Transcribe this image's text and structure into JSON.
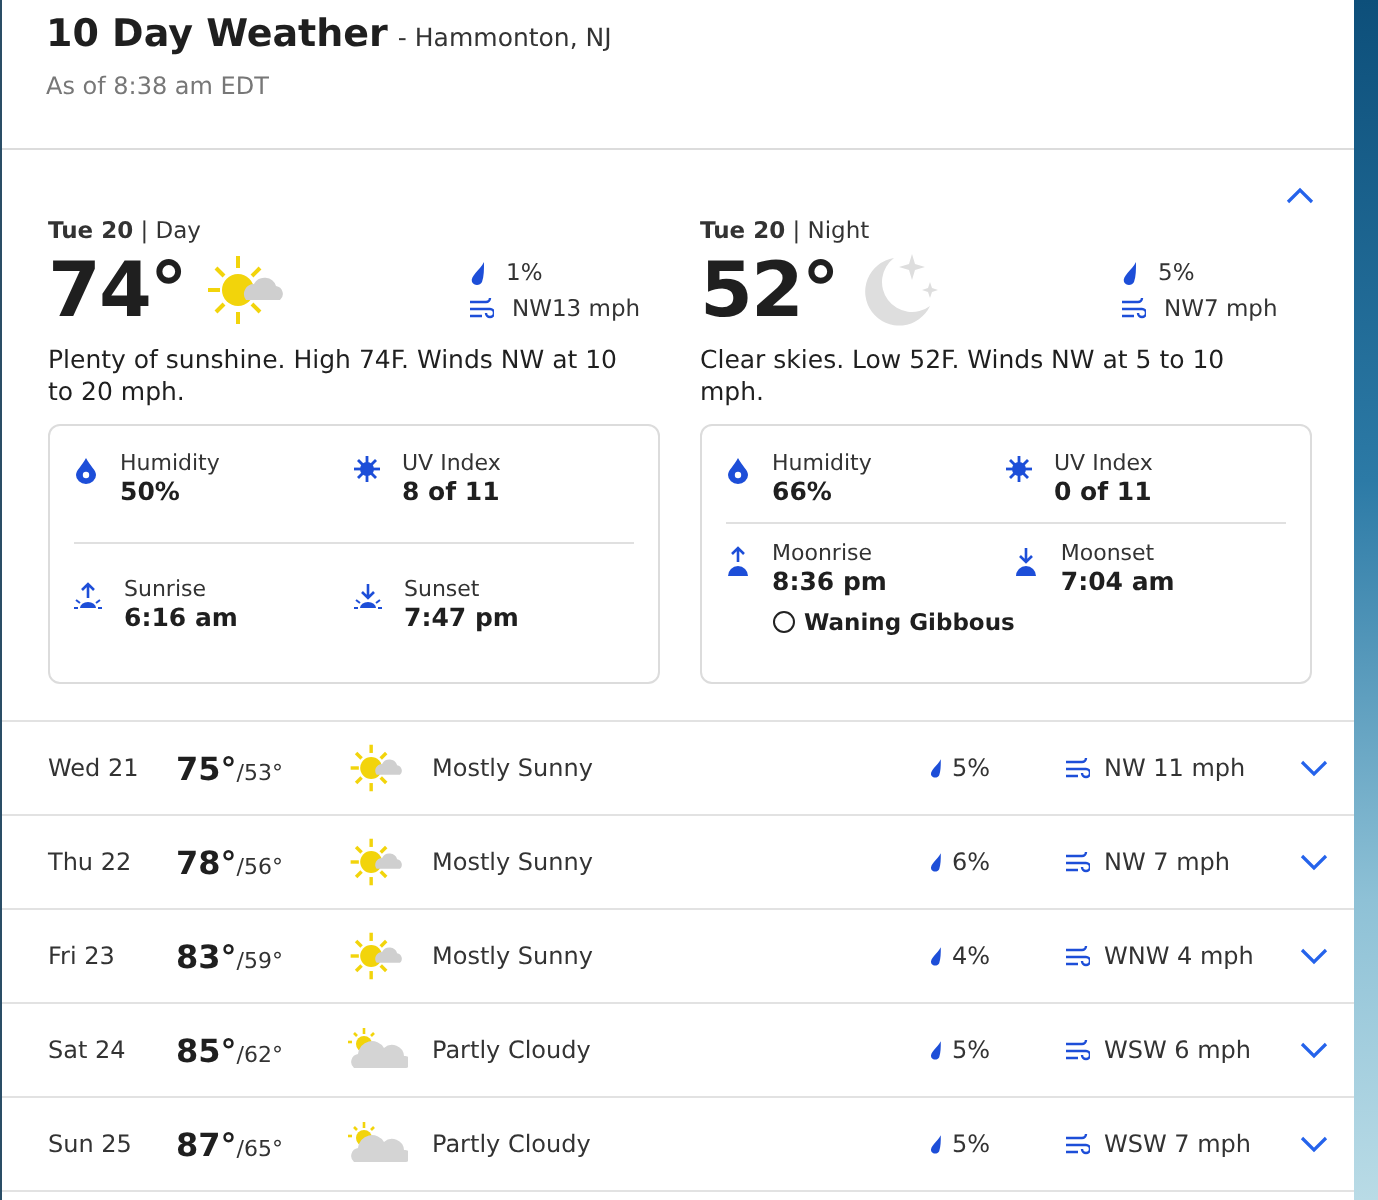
{
  "header": {
    "title": "10 Day Weather",
    "location": "- Hammonton, NJ",
    "updated": "As of 8:38 am EDT"
  },
  "today": {
    "expanded": true,
    "periods": [
      {
        "label": "**Tue 20** | Day",
        "temp": "74°",
        "kind": "mostly-sunny",
        "precip": "1%",
        "wind": "NW13 mph",
        "summary": "Plenty of sunshine. High 74F. Winds NW at 10 to 20 mph.",
        "details": [
          {
            "kind": "humidity",
            "label": "Humidity",
            "value": "50%"
          },
          {
            "kind": "uv",
            "label": "UV Index",
            "value": "8 of 11"
          },
          {
            "kind": "sunrise",
            "label": "Sunrise",
            "value": "6:16 am"
          },
          {
            "kind": "sunset",
            "label": "Sunset",
            "value": "7:47 pm"
          }
        ]
      },
      {
        "label": "**Tue 20** | Night",
        "temp": "52°",
        "kind": "clear-night",
        "precip": "5%",
        "wind": "NW7 mph",
        "summary": "Clear skies. Low 52F. Winds NW at 5 to 10 mph.",
        "details": [
          {
            "kind": "humidity",
            "label": "Humidity",
            "value": "66%"
          },
          {
            "kind": "uv",
            "label": "UV Index",
            "value": "0 of 11"
          },
          {
            "kind": "moonrise",
            "label": "Moonrise",
            "value": "8:36 pm"
          },
          {
            "kind": "moonset",
            "label": "Moonset",
            "value": "7:04 am"
          }
        ],
        "moon_phase": "Waning Gibbous"
      }
    ]
  },
  "days": [
    {
      "day": "Wed 21",
      "high": "75°",
      "low": "/53°",
      "kind": "mostly-sunny",
      "label": "Mostly Sunny",
      "precip": "5%",
      "wind": "NW 11 mph",
      "expanded": false
    },
    {
      "day": "Thu 22",
      "high": "78°",
      "low": "/56°",
      "kind": "mostly-sunny",
      "label": "Mostly Sunny",
      "precip": "6%",
      "wind": "NW 7 mph",
      "expanded": false
    },
    {
      "day": "Fri 23",
      "high": "83°",
      "low": "/59°",
      "kind": "mostly-sunny",
      "label": "Mostly Sunny",
      "precip": "4%",
      "wind": "WNW 4 mph",
      "expanded": false
    },
    {
      "day": "Sat 24",
      "high": "85°",
      "low": "/62°",
      "kind": "partly-cloudy",
      "label": "Partly Cloudy",
      "precip": "5%",
      "wind": "WSW 6 mph",
      "expanded": false
    },
    {
      "day": "Sun 25",
      "high": "87°",
      "low": "/65°",
      "kind": "partly-cloudy",
      "label": "Partly Cloudy",
      "precip": "5%",
      "wind": "WSW 7 mph",
      "expanded": false
    }
  ]
}
